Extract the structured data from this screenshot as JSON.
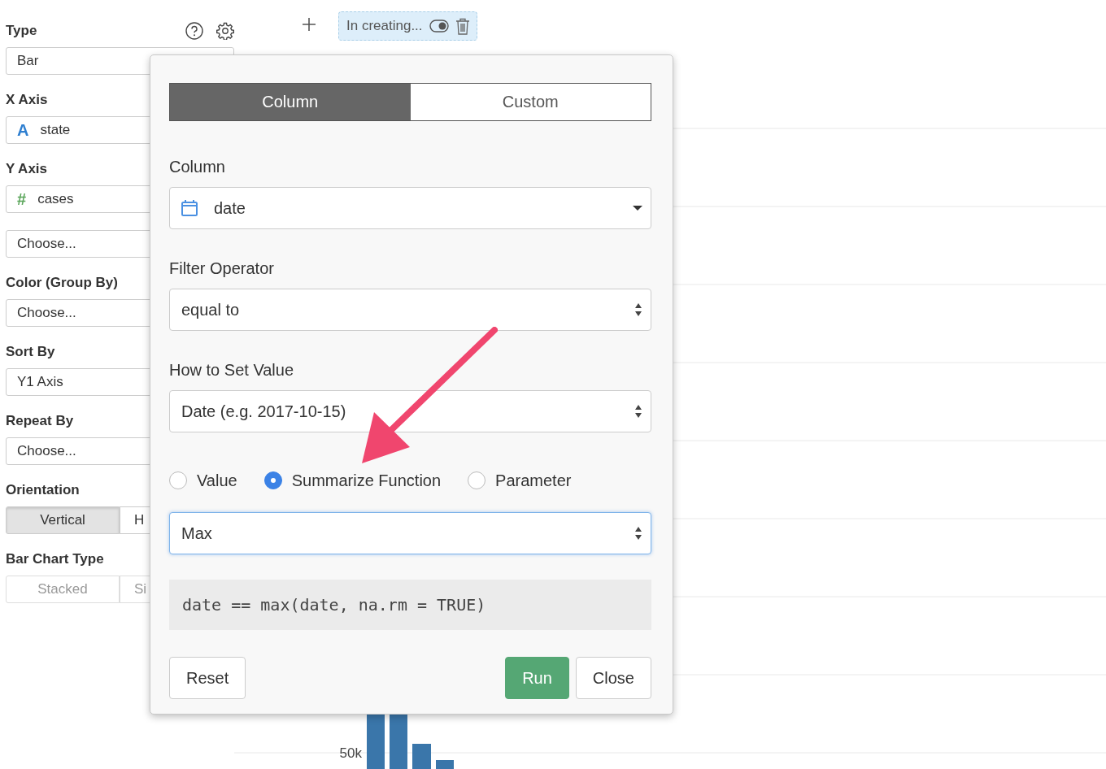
{
  "toolbar": {
    "chip": {
      "label": "In creating...",
      "toggle_on": true
    }
  },
  "sidebar": {
    "sections": [
      {
        "label": "Type",
        "kind": "select",
        "value": "Bar"
      },
      {
        "label": "X Axis",
        "kind": "select",
        "value": "state",
        "glyph": "A",
        "color": "#2f7fd0"
      },
      {
        "label": "Y Axis",
        "kind": "select",
        "value": "cases",
        "glyph": "#",
        "color": "#5aa55a"
      },
      {
        "kind": "select",
        "value": "Choose..."
      },
      {
        "label": "Color (Group By)",
        "kind": "select",
        "value": "Choose..."
      },
      {
        "label": "Sort By",
        "kind": "select",
        "value": "Y1 Axis"
      },
      {
        "label": "Repeat By",
        "kind": "select",
        "value": "Choose..."
      },
      {
        "label": "Orientation",
        "kind": "segmented",
        "options": [
          {
            "label": "Vertical",
            "selected": true
          },
          {
            "label": "H",
            "selected": false
          }
        ]
      },
      {
        "label": "Bar Chart Type",
        "kind": "segmented",
        "disabled": true,
        "options": [
          {
            "label": "Stacked",
            "selected": false
          },
          {
            "label": "Si",
            "selected": false
          }
        ]
      }
    ]
  },
  "chart": {
    "tick_label": "50k"
  },
  "dialog": {
    "tabs": [
      {
        "label": "Column",
        "selected": true
      },
      {
        "label": "Custom",
        "selected": false
      }
    ],
    "fields": [
      {
        "label": "Column",
        "kind": "dropdown",
        "value": "date"
      },
      {
        "label": "Filter Operator",
        "kind": "select",
        "value": "equal to"
      },
      {
        "label": "How to Set Value",
        "kind": "select",
        "value": "Date (e.g. 2017-10-15)"
      }
    ],
    "radios": [
      {
        "label": "Value",
        "selected": false
      },
      {
        "label": "Summarize Function",
        "selected": true
      },
      {
        "label": "Parameter",
        "selected": false
      }
    ],
    "function_select": {
      "value": "Max",
      "focused": true
    },
    "expression": "date == max(date, na.rm = TRUE)",
    "buttons": [
      {
        "label": "Reset",
        "kind": "default"
      },
      {
        "label": "Run",
        "kind": "primary"
      },
      {
        "label": "Close",
        "kind": "default"
      }
    ]
  }
}
